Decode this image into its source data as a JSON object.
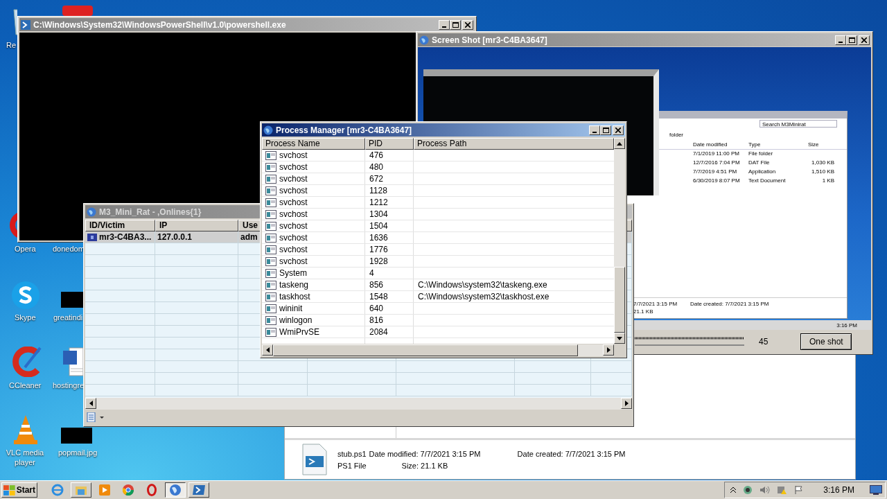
{
  "desktop_icons": [
    {
      "label": "Re",
      "kind": "recycle"
    },
    {
      "label": "Opera",
      "kind": "opera"
    },
    {
      "label": "donedom"
    },
    {
      "label": "Skype",
      "kind": "skype"
    },
    {
      "label": "greatindi",
      "kind": "redacted"
    },
    {
      "label": "CCleaner",
      "kind": "ccleaner"
    },
    {
      "label": "hostingre",
      "kind": "word"
    },
    {
      "label": "VLC media player",
      "kind": "vlc"
    },
    {
      "label": "popmail.jpg",
      "kind": "redacted"
    }
  ],
  "explorer_window": {
    "file_name": "stub.ps1",
    "date_modified": "Date modified: 7/7/2021 3:15 PM",
    "date_created": "Date created: 7/7/2021 3:15 PM",
    "file_type": "PS1 File",
    "size": "Size: 21.1 KB"
  },
  "powershell_window": {
    "title": "C:\\Windows\\System32\\WindowsPowerShell\\v1.0\\powershell.exe"
  },
  "screenshot_window": {
    "title": "Screen Shot [mr3-C4BA3647]",
    "capture": {
      "search_placeholder": "Search M3Minirat",
      "toolbar_text": "folder",
      "columns": [
        "Date modified",
        "Type",
        "Size"
      ],
      "rows": [
        {
          "date": "7/1/2019 11:00 PM",
          "type": "File folder"
        },
        {
          "date": "12/7/2016 7:04 PM",
          "type": "DAT File",
          "size": "1,030 KB"
        },
        {
          "date": "7/7/2019 4:51 PM",
          "type": "Application",
          "size": "1,510 KB"
        },
        {
          "date": "6/30/2019 8:07 PM",
          "type": "Text Document",
          "size": "1 KB"
        }
      ],
      "details": [
        "7/7/2021 3:15 PM",
        "Date created: 7/7/2021 3:15 PM",
        "21.1 KB"
      ],
      "clock": "3:16 PM"
    },
    "quality": "45",
    "button": "One shot"
  },
  "rat_window": {
    "title": "M3_Mini_Rat - ,Onlines{1}",
    "columns": [
      "ID/Victim",
      "IP",
      "Use"
    ],
    "rows": [
      {
        "cells": [
          "mr3-C4BA3...",
          "127.0.0.1",
          "adm"
        ],
        "selected": true
      }
    ]
  },
  "process_manager": {
    "title": "Process Manager [mr3-C4BA3647]",
    "columns": [
      "Process Name",
      "PID",
      "Process Path"
    ],
    "rows": [
      {
        "name": "svchost",
        "pid": "476"
      },
      {
        "name": "svchost",
        "pid": "480"
      },
      {
        "name": "svchost",
        "pid": "672"
      },
      {
        "name": "svchost",
        "pid": "1128"
      },
      {
        "name": "svchost",
        "pid": "1212"
      },
      {
        "name": "svchost",
        "pid": "1304"
      },
      {
        "name": "svchost",
        "pid": "1504"
      },
      {
        "name": "svchost",
        "pid": "1636"
      },
      {
        "name": "svchost",
        "pid": "1776"
      },
      {
        "name": "svchost",
        "pid": "1928"
      },
      {
        "name": "System",
        "pid": "4"
      },
      {
        "name": "taskeng",
        "pid": "856",
        "path": "C:\\Windows\\system32\\taskeng.exe"
      },
      {
        "name": "taskhost",
        "pid": "1548",
        "path": "C:\\Windows\\system32\\taskhost.exe"
      },
      {
        "name": "wininit",
        "pid": "640"
      },
      {
        "name": "winlogon",
        "pid": "816"
      },
      {
        "name": "WmiPrvSE",
        "pid": "2084"
      }
    ]
  },
  "taskbar": {
    "start": "Start",
    "buttons": [
      {
        "kind": "ie",
        "open": false,
        "selected": false
      },
      {
        "kind": "folder",
        "open": true,
        "selected": false
      },
      {
        "kind": "media",
        "open": false,
        "selected": false
      },
      {
        "kind": "chrome",
        "open": false,
        "selected": false
      },
      {
        "kind": "opera",
        "open": false,
        "selected": false
      },
      {
        "kind": "globe",
        "open": true,
        "selected": true
      },
      {
        "kind": "powershell",
        "open": true,
        "selected": false
      }
    ],
    "clock": "3:16 PM"
  }
}
